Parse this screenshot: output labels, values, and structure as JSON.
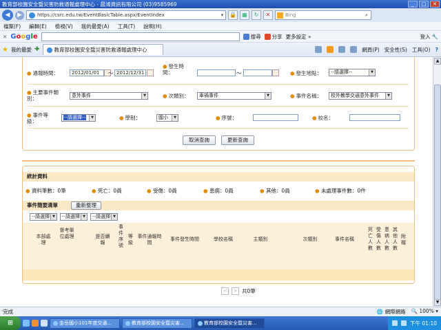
{
  "window": {
    "title": "教育部校園安全暨災害防救通報處理中心 - 晨鴻資訊有限公司 (03)9585969"
  },
  "address": {
    "url": "https://csrc.edu.tw/EventBasicTable.aspx/EventIndex"
  },
  "search": {
    "placeholder": "Bing"
  },
  "menu": {
    "items": [
      "檔案(F)",
      "編輯(E)",
      "檢視(V)",
      "我的最愛(A)",
      "工具(T)",
      "說明(H)"
    ]
  },
  "google": {
    "search_label": "搜尋",
    "share_label": "分享",
    "more_label": "更多設定 »",
    "login_label": "登入"
  },
  "favorites": {
    "label": "我的最愛",
    "tab_title": "教育部校園安全暨災害防救通報處理中心"
  },
  "commands": {
    "page": "網頁(P)",
    "safety": "安全性(S)",
    "tools": "工具(O)"
  },
  "query": {
    "report_time_label": "通報時間：",
    "report_from": "2012/01/01",
    "report_to": "2012/12/31",
    "tilde": "～",
    "occur_time_label": "發生時間：",
    "location_label": "發生地點：",
    "location_value": "--請選擇--",
    "main_category_label": "主要事件類別：",
    "main_category_value": "意外事件",
    "sub_category_label": "次類別：",
    "sub_category_value": "車禍事件",
    "event_name_label": "事件名稱：",
    "event_name_value": "校外教學交通意外事件",
    "level_label": "事件等級：",
    "level_value": "--請選擇--",
    "school_type_label": "學制：",
    "school_type_value": "國小",
    "serial_label": "序號：",
    "school_name_label": "校名：",
    "cancel_button": "取消查詢",
    "update_button": "更新查詢"
  },
  "stats": {
    "title": "統計資料",
    "items": [
      "資料筆數：0筆",
      "死亡：0員",
      "受傷：0員",
      "患病：0員",
      "其他：0員",
      "未處理事件數：0件"
    ],
    "list_title": "事件簡要清單",
    "reorder_button": "重新整理",
    "filters": [
      "--請選擇--",
      "--請選擇--",
      "--請選擇--"
    ],
    "columns": [
      "本部處理",
      "督考單位處理",
      "是否續報",
      "事件序號",
      "等級",
      "事件通報時間",
      "事件發生時間",
      "學校名稱",
      "主類別",
      "次類別",
      "事件名稱",
      "死亡人數",
      "受傷人數",
      "患病人數",
      "其他人數",
      "附檔"
    ],
    "pager_text": "共0筆",
    "prev": "<",
    "next": ">"
  },
  "status": {
    "left": "完成",
    "zone": "網際網路",
    "zoom": "100%"
  },
  "taskbar": {
    "start": "開始",
    "tasks": [
      "金岳國小101年度交通...",
      "教育部校園安全暨災害...",
      "教育部校園安全暨災害..."
    ],
    "clock": "下午 01:10"
  }
}
